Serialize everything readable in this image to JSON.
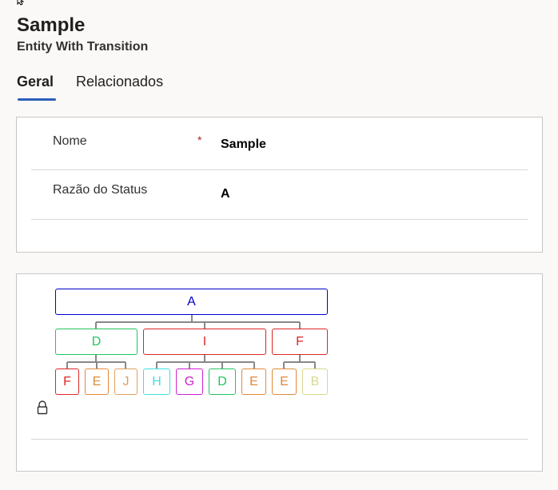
{
  "header": {
    "title": "Sample",
    "subtitle": "Entity With Transition"
  },
  "tabs": [
    {
      "label": "Geral",
      "active": true
    },
    {
      "label": "Relacionados",
      "active": false
    }
  ],
  "form": {
    "fields": [
      {
        "label": "Nome",
        "required_marker": "*",
        "value": "Sample"
      },
      {
        "label": "Razão do Status",
        "required_marker": "",
        "value": "A"
      }
    ]
  },
  "transition_tree": {
    "root": {
      "label": "A",
      "color": "#0000cc"
    },
    "level2": [
      {
        "label": "D",
        "color": "#22c55e"
      },
      {
        "label": "I",
        "color": "#dc2626"
      },
      {
        "label": "F",
        "color": "#dc2626"
      }
    ],
    "level3": [
      {
        "label": "F",
        "color": "#dc2626"
      },
      {
        "label": "E",
        "color": "#e08a3a"
      },
      {
        "label": "J",
        "color": "#e0a060"
      },
      {
        "label": "H",
        "color": "#40e0e0"
      },
      {
        "label": "G",
        "color": "#d020d0"
      },
      {
        "label": "D",
        "color": "#22c55e"
      },
      {
        "label": "E",
        "color": "#e08a3a"
      },
      {
        "label": "E",
        "color": "#e08a3a"
      },
      {
        "label": "B",
        "color": "#d8d890"
      }
    ]
  },
  "icons": {
    "cursor": "mouse-cursor-icon",
    "lock": "lock-icon"
  }
}
